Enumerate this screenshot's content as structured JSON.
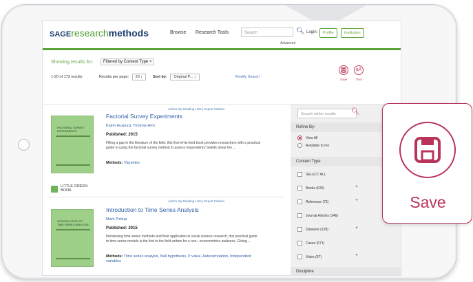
{
  "header": {
    "logo_prefix": "SAGE",
    "logo_research": "research",
    "logo_methods": "methods",
    "browse": "Browse",
    "research_tools": "Research Tools",
    "search_placeholder": "Search",
    "advanced": "Advanced",
    "login_label": "Login:",
    "profile": "Profile",
    "institution": "Institution"
  },
  "results": {
    "showing_label": "Showing results for:",
    "filter_chip": "Filtered by Content Type  ×",
    "count": "1-20 of 173 results",
    "per_page_label": "Results per page:",
    "per_page_value": "20",
    "sort_label": "Sort by:",
    "sort_value": "Original P...",
    "modify_search": "Modify Search",
    "tools": [
      {
        "label": "Save",
        "icon": "save-icon"
      },
      {
        "label": "Text",
        "icon": "text-size-icon"
      }
    ]
  },
  "items": [
    {
      "add_links": "Add to My Reading Lists  |  Export Citation",
      "title": "Factorial Survey Experiments",
      "authors": "Katrin Auspurg, Thomas Hinz",
      "published": "Published: 2015",
      "description": "Filling a gap in the literature of the field, this first-of-its-kind book provides researchers with a practical guide to using the factorial survey method to assess respondents' beliefs about the ...",
      "methods_label": "Methods:",
      "methods_value": "Vignettes",
      "cover_text": "FACTORIAL SURVEY EXPERIMENTS",
      "book_type": "LITTLE GREEN BOOK"
    },
    {
      "add_links": "Add to My Reading Lists  |  Export Citation",
      "title": "Introduction to Time Series Analysis",
      "authors": "Mark Pickup",
      "published": "Published: 2015",
      "description": "Introducing time series methods and their application in social science research, this practical guide to time series models is the first in the field written for a non—econometrics audience. Giving ...",
      "methods_label": "Methods:",
      "methods_value": "Time series analysis, Null hypothesis, P value, Autocorrelation, Independent variables",
      "cover_text": "INTRODUCTION TO TIME SERIES ANALYSIS"
    }
  ],
  "sidebar": {
    "search_placeholder": "Search within results",
    "refine_by": "Refine By:",
    "view_all": "View All",
    "available": "Available to me",
    "content_type": "Content Type",
    "select_all": "SELECT ALL",
    "types": [
      {
        "label": "Books (625)",
        "expandable": true
      },
      {
        "label": "Reference (75)",
        "expandable": true
      },
      {
        "label": "Journal Articles (346)",
        "expandable": false
      },
      {
        "label": "Datasets (128)",
        "expandable": true
      },
      {
        "label": "Cases (571)",
        "expandable": false
      },
      {
        "label": "Video (97)",
        "expandable": true
      }
    ],
    "discipline": "Discipline"
  },
  "callout": {
    "label": "Save",
    "icon": "save-icon",
    "accent_color": "#b8345a"
  },
  "colors": {
    "brand_green": "#5aa33b",
    "brand_navy": "#1d3e6e",
    "link_blue": "#2f5ea7",
    "accent": "#c0405a"
  }
}
